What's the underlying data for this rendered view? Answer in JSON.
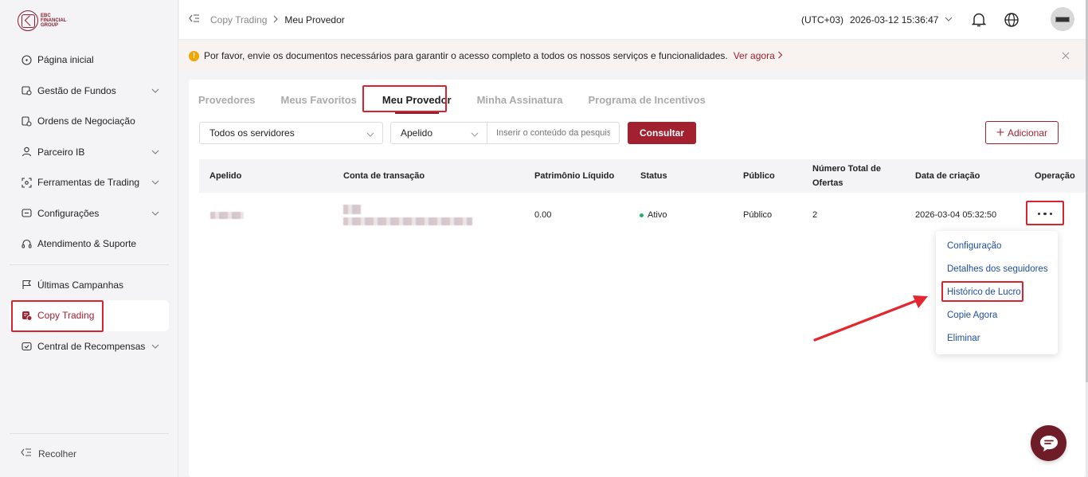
{
  "brand": {
    "logo_text": "EBC FINANCIAL GROUP"
  },
  "sidebar": {
    "items": [
      {
        "label": "Página inicial",
        "icon": "home-icon"
      },
      {
        "label": "Gestão de Fundos",
        "icon": "funds-icon"
      },
      {
        "label": "Ordens de Negociação",
        "icon": "orders-icon"
      },
      {
        "label": "Parceiro IB",
        "icon": "partner-icon"
      },
      {
        "label": "Ferramentas de Trading",
        "icon": "tools-icon"
      },
      {
        "label": "Configurações",
        "icon": "settings-icon"
      },
      {
        "label": "Atendimento & Suporte",
        "icon": "headset-icon"
      },
      {
        "label": "Últimas Campanhas",
        "icon": "flag-icon"
      },
      {
        "label": "Copy Trading",
        "icon": "copy-trading-icon"
      },
      {
        "label": "Central de Recompensas",
        "icon": "rewards-icon"
      }
    ],
    "collapse_label": "Recolher"
  },
  "header": {
    "breadcrumb_parent": "Copy Trading",
    "breadcrumb_current": "Meu Provedor",
    "timezone": "(UTC+03)",
    "datetime": "2026-03-12 15:36:47"
  },
  "notice": {
    "text": "Por favor, envie os documentos necessários para garantir o acesso completo a todos os nossos serviços e funcionalidades.",
    "link": "Ver agora"
  },
  "tabs": [
    "Provedores",
    "Meus Favoritos",
    "Meu Provedor",
    "Minha Assinatura",
    "Programa de Incentivos"
  ],
  "filters": {
    "server": "Todos os servidores",
    "field": "Apelido",
    "search_placeholder": "Inserir o conteúdo da pesquisa",
    "query_button": "Consultar",
    "add_button": "Adicionar"
  },
  "table": {
    "columns": [
      "Apelido",
      "Conta de transação",
      "Patrimônio Líquido",
      "Status",
      "Público",
      "Número Total de Ofertas",
      "Data de criação",
      "Operação"
    ],
    "rows": [
      {
        "equity": "0.00",
        "status": "Ativo",
        "public": "Público",
        "offers": "2",
        "created": "2026-03-04 05:32:50"
      }
    ]
  },
  "dropdown": [
    "Configuração",
    "Detalhes dos seguidores",
    "Histórico de Lucro",
    "Copie Agora",
    "Eliminar"
  ],
  "colors": {
    "brand": "#a3202f",
    "highlight": "#d9232e",
    "link": "#1e4fa0",
    "status_active": "#20b26b"
  }
}
